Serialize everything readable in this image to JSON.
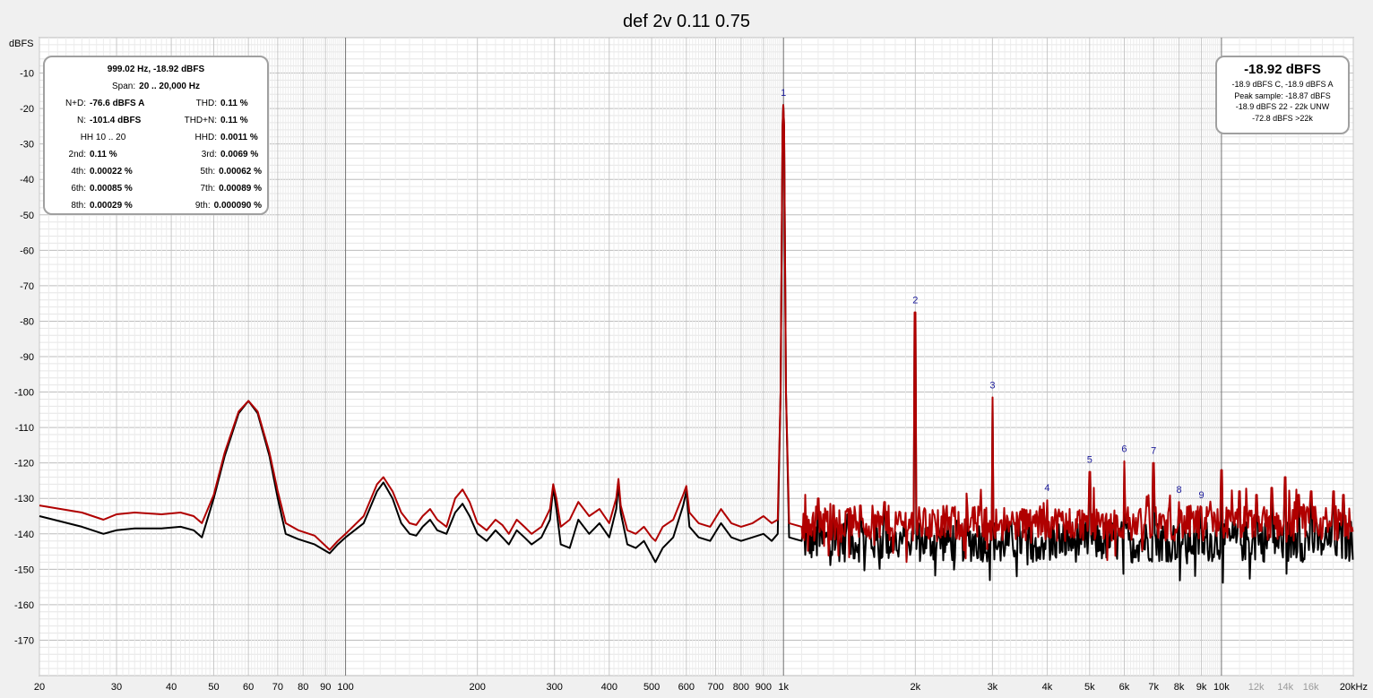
{
  "chart_data": {
    "type": "line",
    "title": "def 2v 0.11 0.75",
    "ylabel": "dBFS",
    "xlabel": "",
    "x_scale": "log",
    "xlim": [
      20,
      20000
    ],
    "ylim": [
      -180,
      0
    ],
    "grid": true,
    "y_ticks": [
      -10,
      -20,
      -30,
      -40,
      -50,
      -60,
      -70,
      -80,
      -90,
      -100,
      -110,
      -120,
      -130,
      -140,
      -150,
      -160,
      -170
    ],
    "x_ticks": [
      {
        "v": 20,
        "label": "20",
        "muted": false
      },
      {
        "v": 30,
        "label": "30",
        "muted": false
      },
      {
        "v": 40,
        "label": "40",
        "muted": false
      },
      {
        "v": 50,
        "label": "50",
        "muted": false
      },
      {
        "v": 60,
        "label": "60",
        "muted": false
      },
      {
        "v": 70,
        "label": "70",
        "muted": false
      },
      {
        "v": 80,
        "label": "80",
        "muted": false
      },
      {
        "v": 90,
        "label": "90",
        "muted": false
      },
      {
        "v": 100,
        "label": "100",
        "muted": false
      },
      {
        "v": 200,
        "label": "200",
        "muted": false
      },
      {
        "v": 300,
        "label": "300",
        "muted": false
      },
      {
        "v": 400,
        "label": "400",
        "muted": false
      },
      {
        "v": 500,
        "label": "500",
        "muted": false
      },
      {
        "v": 600,
        "label": "600",
        "muted": false
      },
      {
        "v": 700,
        "label": "700",
        "muted": false
      },
      {
        "v": 800,
        "label": "800",
        "muted": false
      },
      {
        "v": 900,
        "label": "900",
        "muted": false
      },
      {
        "v": 1000,
        "label": "1k",
        "muted": false
      },
      {
        "v": 2000,
        "label": "2k",
        "muted": false
      },
      {
        "v": 3000,
        "label": "3k",
        "muted": false
      },
      {
        "v": 4000,
        "label": "4k",
        "muted": false
      },
      {
        "v": 5000,
        "label": "5k",
        "muted": false
      },
      {
        "v": 6000,
        "label": "6k",
        "muted": false
      },
      {
        "v": 7000,
        "label": "7k",
        "muted": false
      },
      {
        "v": 8000,
        "label": "8k",
        "muted": false
      },
      {
        "v": 9000,
        "label": "9k",
        "muted": false
      },
      {
        "v": 10000,
        "label": "10k",
        "muted": false
      },
      {
        "v": 12000,
        "label": "12k",
        "muted": true
      },
      {
        "v": 14000,
        "label": "14k",
        "muted": true
      },
      {
        "v": 16000,
        "label": "16k",
        "muted": true
      },
      {
        "v": 20000,
        "label": "20kHz",
        "muted": false
      }
    ],
    "series": [
      {
        "color": "#000000",
        "noise_floor_hf": -142,
        "points": [
          [
            20,
            -135
          ],
          [
            25,
            -138
          ],
          [
            28,
            -140
          ],
          [
            30,
            -139
          ],
          [
            33,
            -138.5
          ],
          [
            38,
            -138.5
          ],
          [
            42,
            -138
          ],
          [
            45,
            -139
          ],
          [
            47,
            -141
          ],
          [
            50,
            -130
          ],
          [
            53,
            -118
          ],
          [
            57,
            -106
          ],
          [
            60,
            -102.5
          ],
          [
            63,
            -106
          ],
          [
            67,
            -118
          ],
          [
            70,
            -130
          ],
          [
            73,
            -140
          ],
          [
            78,
            -141.5
          ],
          [
            85,
            -143
          ],
          [
            92,
            -145.5
          ],
          [
            96,
            -143
          ],
          [
            100,
            -141
          ],
          [
            110,
            -137
          ],
          [
            118,
            -128
          ],
          [
            122,
            -125.5
          ],
          [
            128,
            -130
          ],
          [
            134,
            -137
          ],
          [
            140,
            -140
          ],
          [
            145,
            -140.5
          ],
          [
            150,
            -138
          ],
          [
            156,
            -136
          ],
          [
            162,
            -139
          ],
          [
            170,
            -140
          ],
          [
            178,
            -134
          ],
          [
            185,
            -131.5
          ],
          [
            192,
            -135
          ],
          [
            200,
            -140
          ],
          [
            210,
            -142
          ],
          [
            220,
            -139
          ],
          [
            228,
            -141
          ],
          [
            236,
            -143
          ],
          [
            246,
            -139
          ],
          [
            256,
            -141
          ],
          [
            266,
            -143
          ],
          [
            280,
            -141
          ],
          [
            293,
            -136
          ],
          [
            298,
            -127
          ],
          [
            303,
            -133
          ],
          [
            310,
            -143
          ],
          [
            325,
            -144
          ],
          [
            340,
            -136
          ],
          [
            360,
            -140
          ],
          [
            380,
            -137
          ],
          [
            400,
            -141
          ],
          [
            415,
            -133
          ],
          [
            420,
            -126
          ],
          [
            425,
            -134
          ],
          [
            440,
            -143
          ],
          [
            460,
            -144
          ],
          [
            480,
            -142
          ],
          [
            500,
            -146
          ],
          [
            510,
            -148
          ],
          [
            530,
            -144
          ],
          [
            560,
            -141
          ],
          [
            590,
            -132
          ],
          [
            600,
            -128
          ],
          [
            610,
            -138
          ],
          [
            640,
            -141
          ],
          [
            680,
            -142
          ],
          [
            720,
            -137
          ],
          [
            760,
            -141
          ],
          [
            800,
            -142
          ],
          [
            850,
            -141
          ],
          [
            900,
            -140
          ],
          [
            940,
            -142
          ],
          [
            970,
            -140
          ],
          [
            985,
            -100
          ],
          [
            995,
            -25
          ],
          [
            999,
            -19
          ],
          [
            1003,
            -25
          ],
          [
            1013,
            -100
          ],
          [
            1030,
            -141
          ],
          [
            1100,
            -142
          ]
        ]
      },
      {
        "color": "#b00000",
        "noise_floor_hf": -137,
        "points": [
          [
            20,
            -132
          ],
          [
            25,
            -134
          ],
          [
            28,
            -136
          ],
          [
            30,
            -134.5
          ],
          [
            33,
            -134
          ],
          [
            38,
            -134.5
          ],
          [
            42,
            -134
          ],
          [
            45,
            -135
          ],
          [
            47,
            -137
          ],
          [
            50,
            -129
          ],
          [
            53,
            -117
          ],
          [
            57,
            -105.5
          ],
          [
            60,
            -102.5
          ],
          [
            63,
            -105.5
          ],
          [
            67,
            -117
          ],
          [
            70,
            -128
          ],
          [
            73,
            -137
          ],
          [
            78,
            -139
          ],
          [
            85,
            -140.5
          ],
          [
            92,
            -144.5
          ],
          [
            96,
            -142
          ],
          [
            100,
            -140
          ],
          [
            110,
            -135
          ],
          [
            118,
            -126
          ],
          [
            122,
            -124
          ],
          [
            128,
            -128
          ],
          [
            134,
            -134
          ],
          [
            140,
            -137
          ],
          [
            145,
            -137.5
          ],
          [
            150,
            -135
          ],
          [
            156,
            -133
          ],
          [
            162,
            -136
          ],
          [
            170,
            -138
          ],
          [
            178,
            -130
          ],
          [
            185,
            -127.5
          ],
          [
            192,
            -131
          ],
          [
            200,
            -137
          ],
          [
            210,
            -139
          ],
          [
            220,
            -136
          ],
          [
            228,
            -137.5
          ],
          [
            236,
            -140
          ],
          [
            246,
            -136
          ],
          [
            256,
            -138
          ],
          [
            266,
            -140
          ],
          [
            280,
            -138
          ],
          [
            293,
            -133
          ],
          [
            298,
            -126
          ],
          [
            303,
            -130
          ],
          [
            310,
            -138
          ],
          [
            325,
            -136
          ],
          [
            340,
            -131
          ],
          [
            360,
            -135
          ],
          [
            380,
            -133
          ],
          [
            400,
            -137
          ],
          [
            415,
            -130
          ],
          [
            420,
            -124.5
          ],
          [
            425,
            -132
          ],
          [
            440,
            -139
          ],
          [
            460,
            -140
          ],
          [
            480,
            -138
          ],
          [
            500,
            -141
          ],
          [
            510,
            -142
          ],
          [
            530,
            -138
          ],
          [
            560,
            -136
          ],
          [
            590,
            -129
          ],
          [
            600,
            -126.5
          ],
          [
            610,
            -134
          ],
          [
            640,
            -137
          ],
          [
            680,
            -138
          ],
          [
            720,
            -133
          ],
          [
            760,
            -137
          ],
          [
            800,
            -138
          ],
          [
            850,
            -137
          ],
          [
            900,
            -135
          ],
          [
            940,
            -137
          ],
          [
            970,
            -136
          ],
          [
            985,
            -100
          ],
          [
            995,
            -25
          ],
          [
            999,
            -19
          ],
          [
            1003,
            -25
          ],
          [
            1013,
            -100
          ],
          [
            1030,
            -137
          ],
          [
            1100,
            -138
          ]
        ]
      }
    ],
    "spikes": [
      [
        1020,
        -127
      ],
      [
        1200,
        -130
      ],
      [
        1300,
        -132
      ],
      [
        1400,
        -133
      ],
      [
        1500,
        -132
      ],
      [
        1700,
        -131
      ],
      [
        2000,
        -77.5
      ],
      [
        3000,
        -101.5
      ],
      [
        4000,
        -130.5
      ],
      [
        5000,
        -122.5
      ],
      [
        6000,
        -119.5
      ],
      [
        7000,
        -120
      ],
      [
        8000,
        -131
      ],
      [
        9000,
        -132.5
      ],
      [
        10000,
        -122
      ],
      [
        11000,
        -128
      ],
      [
        12000,
        -129
      ],
      [
        13000,
        -127
      ],
      [
        14000,
        -124
      ],
      [
        15000,
        -129
      ],
      [
        16000,
        -128
      ],
      [
        18000,
        -128
      ],
      [
        19000,
        -129
      ]
    ],
    "harmonic_markers": [
      {
        "n": "1",
        "x": 1000,
        "y": -19
      },
      {
        "n": "2",
        "x": 2000,
        "y": -77.5
      },
      {
        "n": "3",
        "x": 3000,
        "y": -101.5
      },
      {
        "n": "4",
        "x": 4000,
        "y": -130.5
      },
      {
        "n": "5",
        "x": 5000,
        "y": -122.5
      },
      {
        "n": "6",
        "x": 6000,
        "y": -119.5
      },
      {
        "n": "7",
        "x": 7000,
        "y": -120
      },
      {
        "n": "8",
        "x": 8000,
        "y": -131
      },
      {
        "n": "9",
        "x": 9000,
        "y": -132.5
      }
    ]
  },
  "left_box": {
    "header": "999.02 Hz, -18.92 dBFS",
    "span_label": "Span:",
    "span_value": "20 .. 20,000 Hz",
    "nd_label": "N+D:",
    "nd_value": "-76.6 dBFS A",
    "thd_label": "THD:",
    "thd_value": "0.11 %",
    "n_label": "N:",
    "n_value": "-101.4 dBFS",
    "thdn_label": "THD+N:",
    "thdn_value": "0.11 %",
    "hh_label": "HH 10 .. 20",
    "hhd_label": "HHD:",
    "hhd_value": "0.0011 %",
    "h2_label": "2nd:",
    "h2_value": "0.11 %",
    "h3_label": "3rd:",
    "h3_value": "0.0069 %",
    "h4_label": "4th:",
    "h4_value": "0.00022 %",
    "h5_label": "5th:",
    "h5_value": "0.00062 %",
    "h6_label": "6th:",
    "h6_value": "0.00085 %",
    "h7_label": "7th:",
    "h7_value": "0.00089 %",
    "h8_label": "8th:",
    "h8_value": "0.00029 %",
    "h9_label": "9th:",
    "h9_value": "0.000090 %"
  },
  "right_box": {
    "big": "-18.92 dBFS",
    "line1": "-18.9 dBFS C, -18.9 dBFS A",
    "line2": "Peak sample: -18.87 dBFS",
    "line3": "-18.9 dBFS 22 - 22k UNW",
    "line4": "-72.8 dBFS >22k"
  }
}
